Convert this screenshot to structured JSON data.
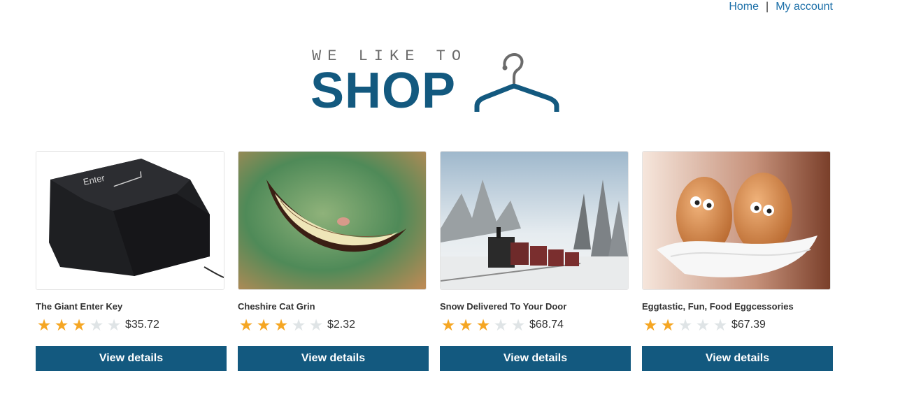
{
  "nav": {
    "home_label": "Home",
    "separator": "|",
    "account_label": "My account"
  },
  "logo": {
    "tagline": "WE LIKE TO",
    "word": "SHOP",
    "icon": "hanger-icon"
  },
  "colors": {
    "brand": "#13597f",
    "link": "#1c6fa8",
    "star_on": "#f5a623",
    "star_off": "#dfe4e6"
  },
  "products": [
    {
      "title": "The Giant Enter Key",
      "rating": 3,
      "max_rating": 5,
      "price": "$35.72",
      "button": "View details",
      "image": "giant-enter-key-image"
    },
    {
      "title": "Cheshire Cat Grin",
      "rating": 3,
      "max_rating": 5,
      "price": "$2.32",
      "button": "View details",
      "image": "cheshire-cat-grin-image"
    },
    {
      "title": "Snow Delivered To Your Door",
      "rating": 3,
      "max_rating": 5,
      "price": "$68.74",
      "button": "View details",
      "image": "snow-train-image"
    },
    {
      "title": "Eggtastic, Fun, Food Eggcessories",
      "rating": 2,
      "max_rating": 5,
      "price": "$67.39",
      "button": "View details",
      "image": "eggs-on-feathers-image"
    }
  ]
}
